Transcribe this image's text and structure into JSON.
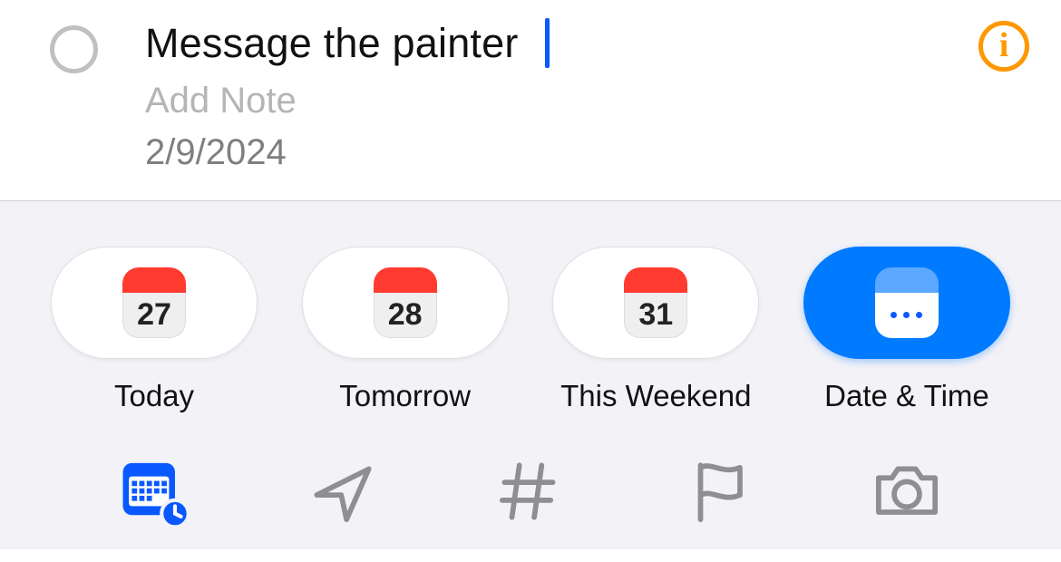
{
  "task": {
    "title": "Message the painter",
    "note_placeholder": "Add Note",
    "date_text": "2/9/2024"
  },
  "chips": [
    {
      "key": "today",
      "day": "27",
      "label": "Today",
      "variant": "red"
    },
    {
      "key": "tomorrow",
      "day": "28",
      "label": "Tomorrow",
      "variant": "red"
    },
    {
      "key": "weekend",
      "day": "31",
      "label": "This Weekend",
      "variant": "red"
    },
    {
      "key": "datetime",
      "day": "",
      "label": "Date & Time",
      "variant": "accent"
    }
  ],
  "toolbar_active": "calendar"
}
